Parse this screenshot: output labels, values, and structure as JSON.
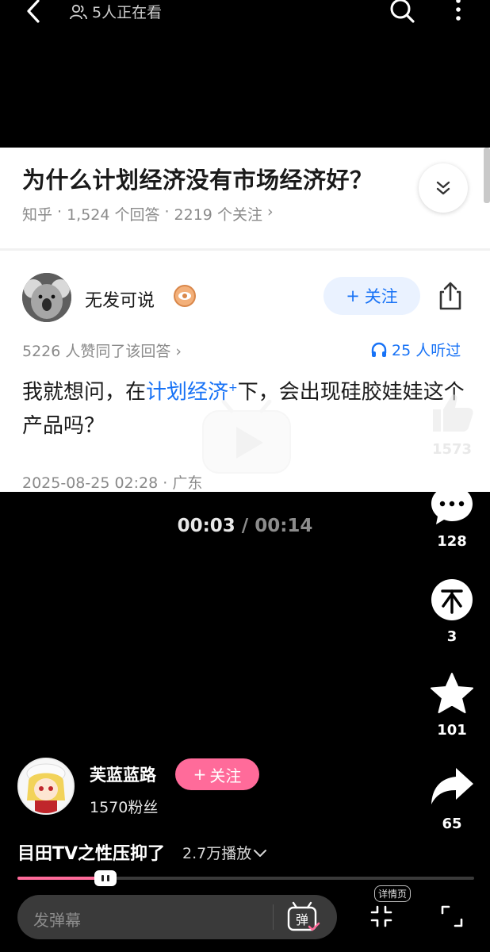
{
  "topbar": {
    "viewers": "5人正在看"
  },
  "zhihu": {
    "question_title": "为什么计划经济没有市场经济好？",
    "meta": [
      "知乎",
      "·",
      "1,524 个回答",
      "·",
      "2219 个关注",
      "›"
    ],
    "author_name": "无发可说",
    "follow_label": "关注",
    "upvote_text": "5226 人赞同了该回答 ›",
    "listeners_text": "25 人听过",
    "answer_pre": "我就想问，在",
    "answer_link": "计划经济",
    "answer_sup": "+",
    "answer_post": "下，会出现硅胶娃娃这个产品吗？",
    "answer_time": "2025-08-25 02:28 · 广东"
  },
  "player": {
    "current_time": "00:03",
    "separator": "/",
    "duration": "00:14",
    "progress_fraction": 0.2
  },
  "rail": {
    "like_count": "1573",
    "comment_count": "128",
    "coin_count": "3",
    "star_count": "101",
    "share_count": "65"
  },
  "uploader": {
    "name": "芙蓝蓝路",
    "follow_label": "关注",
    "fans": "1570粉丝"
  },
  "video": {
    "title": "目田TV之性压抑了",
    "plays": "2.7万播放"
  },
  "bottom": {
    "danmaku_placeholder": "发弹幕",
    "danmaku_button": "弹",
    "details_label": "详情页"
  },
  "colors": {
    "accent_pink": "#ff6b9a",
    "zhihu_blue": "#1772f6"
  }
}
